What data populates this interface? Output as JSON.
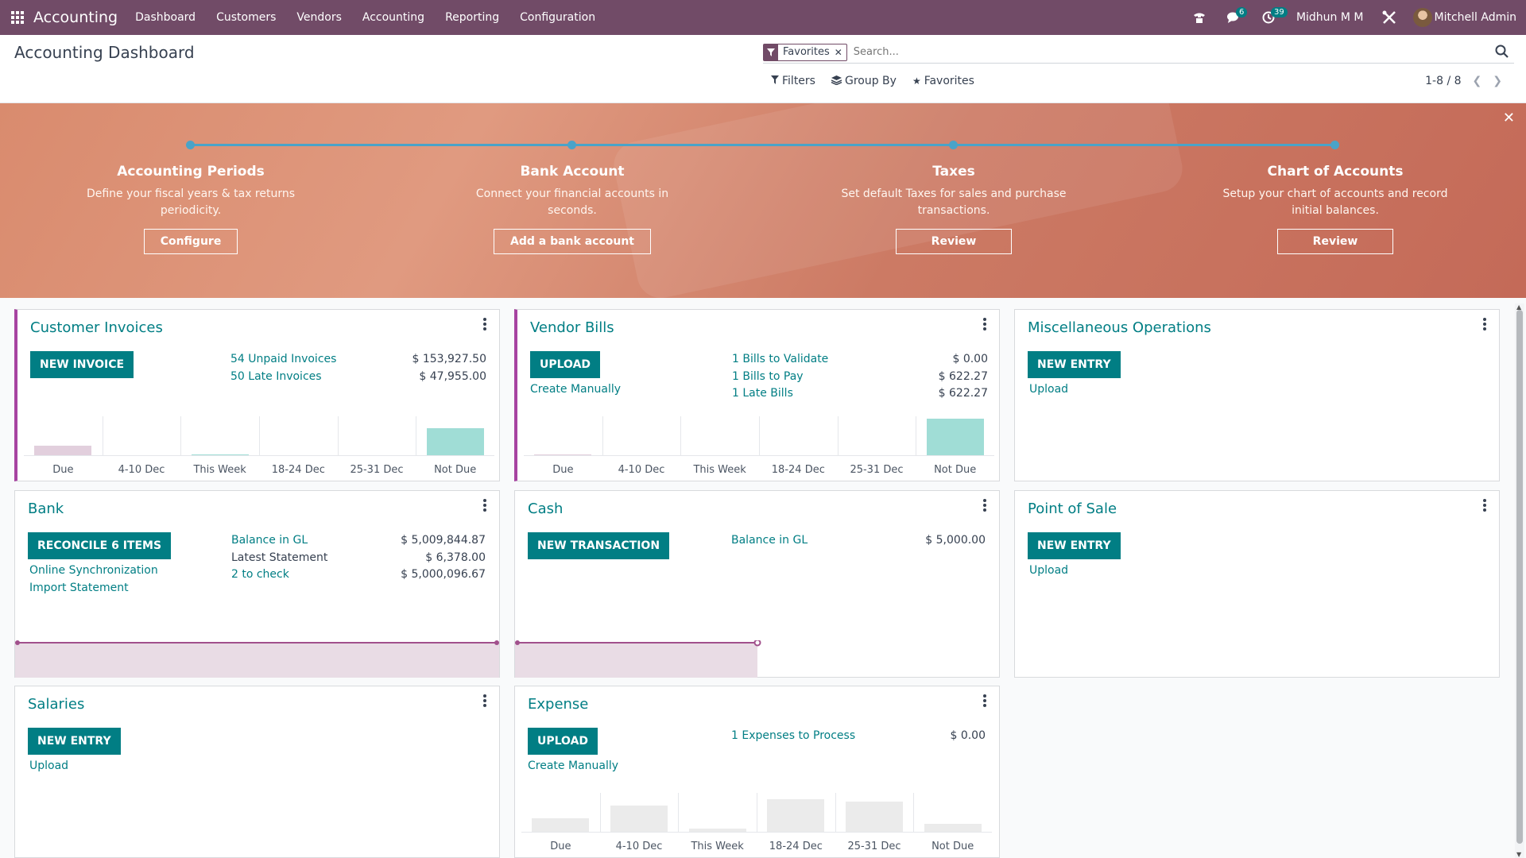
{
  "navbar": {
    "brand": "Accounting",
    "menu": [
      "Dashboard",
      "Customers",
      "Vendors",
      "Accounting",
      "Reporting",
      "Configuration"
    ],
    "messages_count": "6",
    "activities_count": "39",
    "company": "Midhun M M",
    "user": "Mitchell Admin"
  },
  "control": {
    "title": "Accounting Dashboard",
    "facet": "Favorites",
    "search_placeholder": "Search...",
    "filters": "Filters",
    "group_by": "Group By",
    "favorites": "Favorites",
    "pager": "1-8 / 8"
  },
  "banner": {
    "steps": [
      {
        "title": "Accounting Periods",
        "desc": "Define your fiscal years & tax returns periodicity.",
        "button": "Configure"
      },
      {
        "title": "Bank Account",
        "desc": "Connect your financial accounts in seconds.",
        "button": "Add a bank account"
      },
      {
        "title": "Taxes",
        "desc": "Set default Taxes for sales and purchase transactions.",
        "button": "Review"
      },
      {
        "title": "Chart of Accounts",
        "desc": "Setup your chart of accounts and record initial balances.",
        "button": "Review"
      }
    ]
  },
  "cards": {
    "customer_invoices": {
      "title": "Customer Invoices",
      "button": "NEW INVOICE",
      "rows": [
        {
          "label": "54 Unpaid Invoices",
          "amount": "$ 153,927.50"
        },
        {
          "label": "50 Late Invoices",
          "amount": "$ 47,955.00"
        }
      ]
    },
    "vendor_bills": {
      "title": "Vendor Bills",
      "button": "UPLOAD",
      "create": "Create Manually",
      "rows": [
        {
          "label": "1 Bills to Validate",
          "amount": "$ 0.00"
        },
        {
          "label": "1 Bills to Pay",
          "amount": "$ 622.27"
        },
        {
          "label": "1 Late Bills",
          "amount": "$ 622.27"
        }
      ]
    },
    "misc": {
      "title": "Miscellaneous Operations",
      "button": "NEW ENTRY",
      "upload": "Upload"
    },
    "bank": {
      "title": "Bank",
      "button": "RECONCILE 6 ITEMS",
      "links": [
        "Online Synchronization",
        "Import Statement"
      ],
      "rows": [
        {
          "label": "Balance in GL",
          "amount": "$ 5,009,844.87"
        },
        {
          "label": "Latest Statement",
          "amount": "$ 6,378.00"
        },
        {
          "label": "2 to check",
          "amount": "$ 5,000,096.67"
        }
      ]
    },
    "cash": {
      "title": "Cash",
      "button": "NEW TRANSACTION",
      "rows": [
        {
          "label": "Balance in GL",
          "amount": "$ 5,000.00"
        }
      ]
    },
    "pos": {
      "title": "Point of Sale",
      "button": "NEW ENTRY",
      "upload": "Upload"
    },
    "salaries": {
      "title": "Salaries",
      "button": "NEW ENTRY",
      "upload": "Upload"
    },
    "expense": {
      "title": "Expense",
      "button": "UPLOAD",
      "create": "Create Manually",
      "rows": [
        {
          "label": "1 Expenses to Process",
          "amount": "$ 0.00"
        }
      ]
    }
  },
  "chart_data": [
    {
      "type": "bar",
      "categories": [
        "Due",
        "4-10 Dec",
        "This Week",
        "18-24 Dec",
        "25-31 Dec",
        "Not Due"
      ],
      "values": [
        0.28,
        0,
        0.04,
        0,
        0,
        0.72
      ],
      "colors": [
        "#e2cfdd",
        "#e2cfdd",
        "#a0ddd6",
        "#a0ddd6",
        "#a0ddd6",
        "#a0ddd6"
      ]
    },
    {
      "type": "bar",
      "categories": [
        "Due",
        "4-10 Dec",
        "This Week",
        "18-24 Dec",
        "25-31 Dec",
        "Not Due"
      ],
      "values": [
        0.05,
        0,
        0,
        0,
        0,
        0.97
      ],
      "colors": [
        "#e2cfdd",
        "#e2cfdd",
        "#a0ddd6",
        "#a0ddd6",
        "#a0ddd6",
        "#a0ddd6"
      ]
    },
    {
      "type": "bar",
      "categories": [
        "Due",
        "4-10 Dec",
        "This Week",
        "18-24 Dec",
        "25-31 Dec",
        "Not Due"
      ],
      "values": [
        0.38,
        0.7,
        0.1,
        0.88,
        0.82,
        0.22
      ],
      "colors": [
        "#ebebeb",
        "#ebebeb",
        "#ebebeb",
        "#ebebeb",
        "#ebebeb",
        "#ebebeb"
      ]
    }
  ],
  "colors": {
    "brand": "#714b67",
    "primary": "#017e84",
    "accent": "#a743a1"
  }
}
